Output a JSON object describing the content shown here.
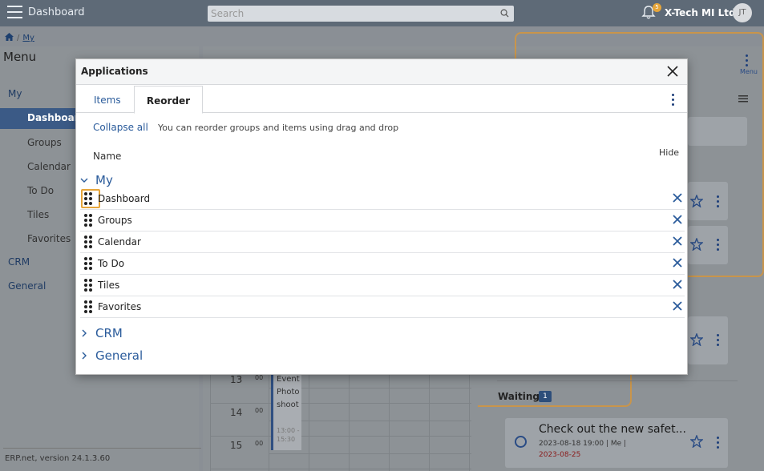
{
  "topbar": {
    "app_title": "Dashboard",
    "search_placeholder": "Search",
    "notification_count": "5",
    "company": "X-Tech MI Ltd.",
    "avatar_initials": "JT"
  },
  "breadcrumb": {
    "current": "My"
  },
  "sidebar": {
    "title": "Menu",
    "group_my": "My",
    "items": [
      "Dashboard",
      "Groups",
      "Calendar",
      "To Do",
      "Tiles",
      "Favorites"
    ],
    "group_crm": "CRM",
    "group_general": "General",
    "version": "ERP.net, version 24.1.3.60"
  },
  "background": {
    "menu_label": "Menu",
    "waiting_label": "Waiting",
    "waiting_count": "1",
    "task": {
      "title": "Check out the new safet...",
      "meta": "2023-08-18 19:00 | Me |",
      "due": "2023-08-25"
    },
    "calendar": {
      "hours": [
        "13",
        "14",
        "15"
      ],
      "minutes": "00",
      "event_title": "Event Photoshoot",
      "event_time": "13:00 - 15:30"
    }
  },
  "modal": {
    "title": "Applications",
    "tabs": [
      "Items",
      "Reorder"
    ],
    "active_tab": "Reorder",
    "collapse_all": "Collapse all",
    "hint": "You can reorder groups and items using drag and drop",
    "col_name": "Name",
    "col_hide": "Hide",
    "groups": [
      {
        "label": "My",
        "expanded": true,
        "items": [
          "Dashboard",
          "Groups",
          "Calendar",
          "To Do",
          "Tiles",
          "Favorites"
        ]
      },
      {
        "label": "CRM",
        "expanded": false
      },
      {
        "label": "General",
        "expanded": false
      }
    ]
  },
  "colors": {
    "accent": "#2a5b9b",
    "focus_outline": "#e6a53a",
    "topbar": "#5e6a77"
  }
}
